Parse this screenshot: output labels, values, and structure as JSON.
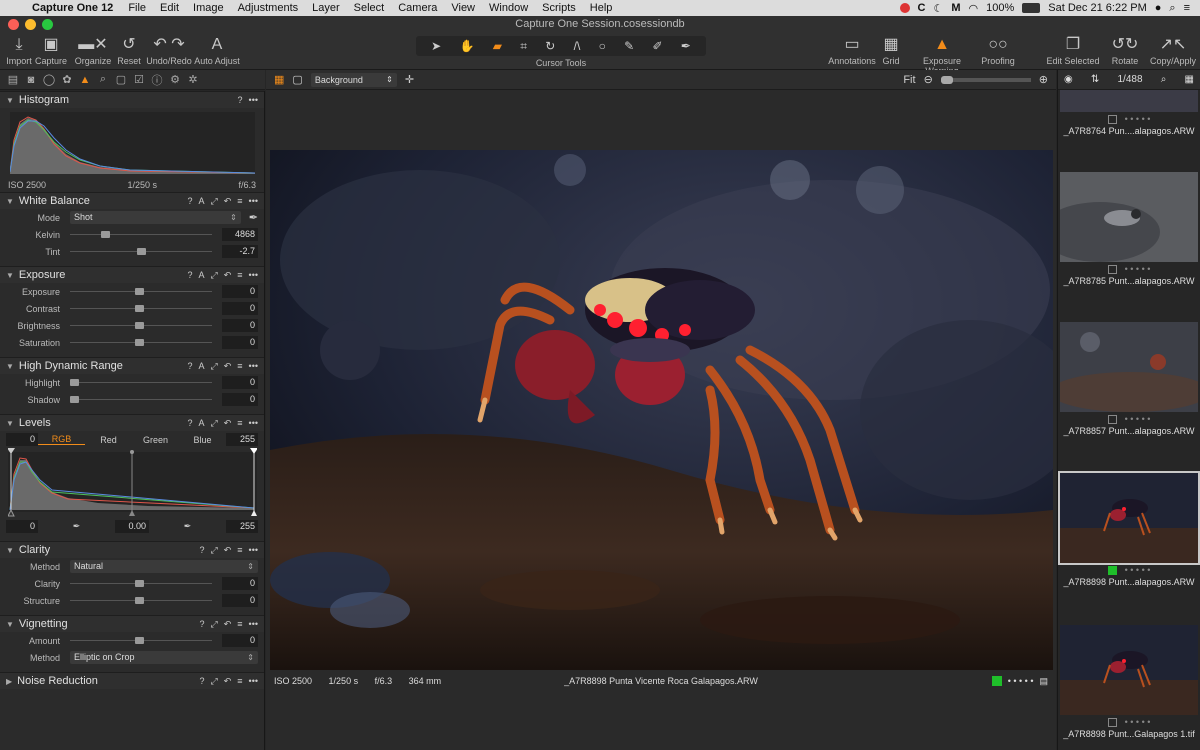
{
  "menubar": {
    "app": "Capture One 12",
    "items": [
      "File",
      "Edit",
      "Image",
      "Adjustments",
      "Layer",
      "Select",
      "Camera",
      "View",
      "Window",
      "Scripts",
      "Help"
    ],
    "battery": "100%",
    "datetime": "Sat Dec 21  6:22 PM"
  },
  "window": {
    "title": "Capture One Session.cosessiondb"
  },
  "toolbar": {
    "import": "Import",
    "capture": "Capture",
    "organize": "Organize",
    "reset": "Reset",
    "undo_redo": "Undo/Redo",
    "auto_adjust": "Auto Adjust",
    "cursor_tools": "Cursor Tools",
    "annotations": "Annotations",
    "grid": "Grid",
    "exposure_warning": "Exposure Warning",
    "proofing": "Proofing",
    "edit_selected": "Edit Selected",
    "rotate": "Rotate",
    "copy_apply": "Copy/Apply"
  },
  "histogram": {
    "title": "Histogram",
    "iso": "ISO 2500",
    "shutter": "1/250 s",
    "aperture": "f/6.3"
  },
  "white_balance": {
    "title": "White Balance",
    "mode_label": "Mode",
    "mode": "Shot",
    "kelvin_label": "Kelvin",
    "kelvin": "4868",
    "kelvin_level": 0.22,
    "tint_label": "Tint",
    "tint": "-2.7",
    "tint_level": 0.47
  },
  "exposure": {
    "title": "Exposure",
    "rows": [
      {
        "label": "Exposure",
        "value": "0"
      },
      {
        "label": "Contrast",
        "value": "0"
      },
      {
        "label": "Brightness",
        "value": "0"
      },
      {
        "label": "Saturation",
        "value": "0"
      }
    ]
  },
  "hdr": {
    "title": "High Dynamic Range",
    "rows": [
      {
        "label": "Highlight",
        "value": "0"
      },
      {
        "label": "Shadow",
        "value": "0"
      }
    ]
  },
  "levels": {
    "title": "Levels",
    "left": "0",
    "right": "255",
    "tabs": [
      "RGB",
      "Red",
      "Green",
      "Blue"
    ],
    "out_left": "0",
    "mid": "0.00",
    "out_right": "255"
  },
  "clarity": {
    "title": "Clarity",
    "method_label": "Method",
    "method": "Natural",
    "rows": [
      {
        "label": "Clarity",
        "value": "0"
      },
      {
        "label": "Structure",
        "value": "0"
      }
    ]
  },
  "vignetting": {
    "title": "Vignetting",
    "amount_label": "Amount",
    "amount": "0",
    "method_label": "Method",
    "method": "Elliptic on Crop"
  },
  "noise": {
    "title": "Noise Reduction"
  },
  "viewer": {
    "background": "Background",
    "fit": "Fit",
    "iso": "ISO 2500",
    "shutter": "1/250 s",
    "aperture": "f/6.3",
    "focal": "364 mm",
    "filename": "_A7R8898 Punta Vicente Roca  Galapagos.ARW"
  },
  "browser": {
    "count": "1/488",
    "thumbs": [
      {
        "name": "_A7R8764 Pun....alapagos.ARW"
      },
      {
        "name": "_A7R8785 Punt...alapagos.ARW"
      },
      {
        "name": "_A7R8857 Punt...alapagos.ARW"
      },
      {
        "name": "_A7R8898 Punt...alapagos.ARW"
      },
      {
        "name": "_A7R8898 Punt...Galapagos 1.tif"
      }
    ]
  },
  "colors": {
    "accent": "#f28c1a",
    "green_tag": "#1fbf2a"
  }
}
